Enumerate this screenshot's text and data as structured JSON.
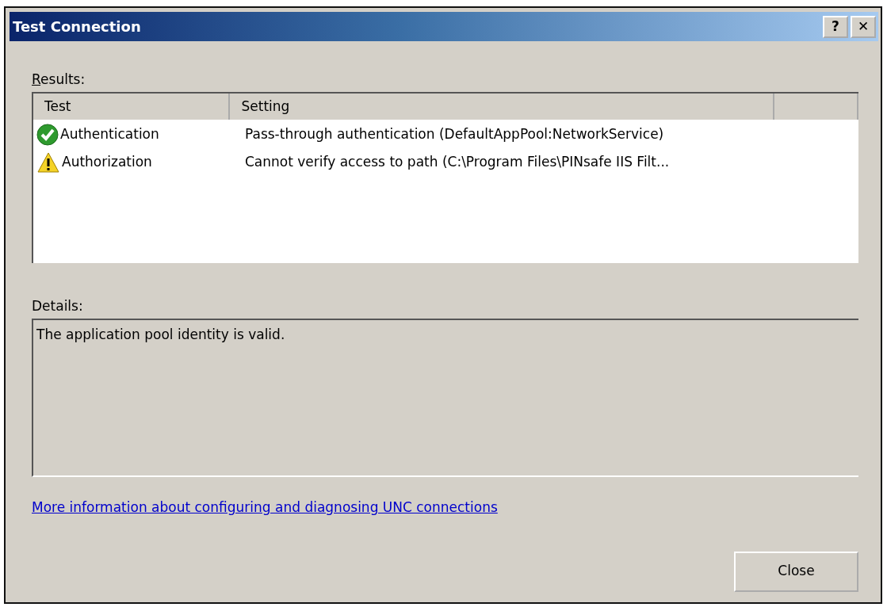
{
  "window": {
    "title": "Test Connection",
    "title_buttons": [
      "?",
      "✕"
    ]
  },
  "results": {
    "label": "Results:",
    "access_key_underlined": true,
    "columns": [
      "Test",
      "Setting"
    ],
    "rows": [
      {
        "kind": "ok",
        "test": "Authentication",
        "setting": "Pass-through authentication (DefaultAppPool:NetworkService)"
      },
      {
        "kind": "warning",
        "test": "Authorization",
        "setting": "Cannot verify access to path (C:\\Program Files\\PINsafe IIS Filt..."
      }
    ]
  },
  "details": {
    "label": "Details:",
    "text": "The application pool identity is valid."
  },
  "link": "More information about configuring and diagnosing UNC connections",
  "buttons": [
    "Close"
  ]
}
